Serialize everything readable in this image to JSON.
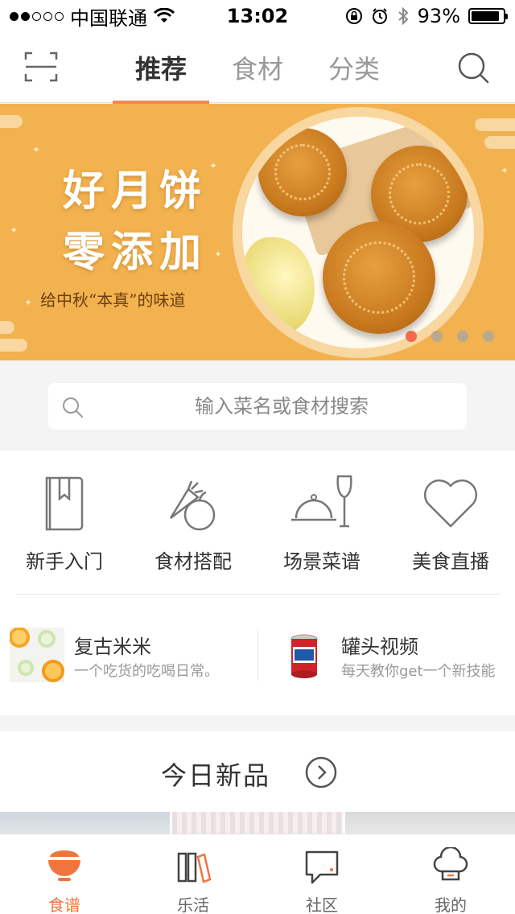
{
  "status_bar": {
    "carrier": "中国联通",
    "time": "13:02",
    "battery": "93%",
    "signal_bars_filled": 2,
    "signal_bars_total": 5
  },
  "header": {
    "tabs": [
      {
        "label": "推荐",
        "active": true
      },
      {
        "label": "食材",
        "active": false
      },
      {
        "label": "分类",
        "active": false
      }
    ],
    "left_icon": "scan-icon",
    "right_icon": "search-icon"
  },
  "banner": {
    "title_line1": "好月饼",
    "title_line2": "零添加",
    "subtitle": "给中秋“本真”的味道",
    "page_count": 4,
    "current_page": 1,
    "accent_color": "#f2b24f"
  },
  "search": {
    "placeholder": "输入菜名或食材搜索"
  },
  "categories": [
    {
      "label": "新手入门",
      "icon": "book-icon"
    },
    {
      "label": "食材搭配",
      "icon": "vegetables-icon"
    },
    {
      "label": "场景菜谱",
      "icon": "cloche-wine-icon"
    },
    {
      "label": "美食直播",
      "icon": "heart-icon"
    }
  ],
  "promos": [
    {
      "title": "复古米米",
      "subtitle": "一个吃货的吃喝日常。",
      "thumb": "orange-slices-thumb"
    },
    {
      "title": "罐头视频",
      "subtitle": "每天教你get一个新技能",
      "thumb": "can-thumb"
    }
  ],
  "today": {
    "title": "今日新品",
    "arrow_icon": "chevron-right-circle-icon"
  },
  "tabbar": [
    {
      "label": "食谱",
      "icon": "bowl-icon",
      "active": true
    },
    {
      "label": "乐活",
      "icon": "books-icon",
      "active": false
    },
    {
      "label": "社区",
      "icon": "chat-icon",
      "active": false
    },
    {
      "label": "我的",
      "icon": "chef-hat-icon",
      "active": false
    }
  ],
  "colors": {
    "accent": "#f0743e",
    "tab_underline": "#f3894e",
    "banner_bg": "#f2b24f"
  }
}
